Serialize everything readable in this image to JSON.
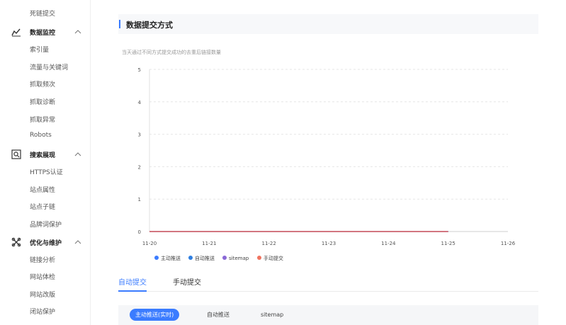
{
  "sidebar": {
    "top_item": "死链提交",
    "groups": [
      {
        "label": "数据监控",
        "icon": "chart-trend-icon",
        "items": [
          "索引量",
          "流量与关键词",
          "抓取频次",
          "抓取诊断",
          "抓取异常",
          "Robots"
        ]
      },
      {
        "label": "搜索展现",
        "icon": "search-display-icon",
        "items": [
          "HTTPS认证",
          "站点属性",
          "站点子链",
          "品牌词保护"
        ]
      },
      {
        "label": "优化与维护",
        "icon": "optimize-icon",
        "items": [
          "链接分析",
          "网站体检",
          "网站改版",
          "闭站保护"
        ]
      }
    ]
  },
  "card": {
    "title": "数据提交方式",
    "description": "当天通过不同方式提交成功的去重后链接数量"
  },
  "chart_data": {
    "type": "line",
    "x": [
      "11-20",
      "11-21",
      "11-22",
      "11-23",
      "11-24",
      "11-25",
      "11-26"
    ],
    "yticks": [
      0,
      1,
      2,
      3,
      4,
      5
    ],
    "ylim": [
      0,
      5
    ],
    "grid": true,
    "legend_position": "bottom",
    "series": [
      {
        "name": "主动推送",
        "color": "#3b7cff",
        "values": [
          0,
          0,
          0,
          0,
          0,
          0
        ]
      },
      {
        "name": "自动推送",
        "color": "#2f7fe0",
        "values": [
          0,
          0,
          0,
          0,
          0,
          0
        ]
      },
      {
        "name": "sitemap",
        "color": "#8a68d6",
        "values": [
          0,
          0,
          0,
          0,
          0,
          0
        ]
      },
      {
        "name": "手动提交",
        "color": "#f0735f",
        "values": [
          0,
          0,
          0,
          0,
          0,
          0
        ]
      }
    ]
  },
  "tabs": [
    {
      "label": "自动提交",
      "active": true
    },
    {
      "label": "手动提交",
      "active": false
    }
  ],
  "subtabs": [
    {
      "label": "主动推送(实时)",
      "active": true
    },
    {
      "label": "自动推送",
      "active": false
    },
    {
      "label": "sitemap",
      "active": false
    }
  ],
  "colors": {
    "accent": "#3b7cff",
    "line": "#f0735f"
  }
}
